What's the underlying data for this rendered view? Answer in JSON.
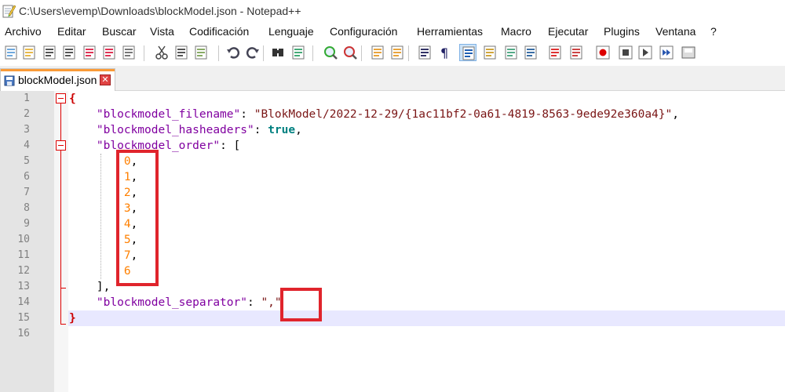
{
  "window": {
    "title": "C:\\Users\\evemp\\Downloads\\blockModel.json - Notepad++"
  },
  "menu": [
    "Archivo",
    "Editar",
    "Buscar",
    "Vista",
    "Codificación",
    "Lenguaje",
    "Configuración",
    "Herramientas",
    "Macro",
    "Ejecutar",
    "Plugins",
    "Ventana",
    "?"
  ],
  "toolbar_icons": [
    "new-file-icon",
    "open-file-icon",
    "save-icon",
    "save-all-icon",
    "close-icon",
    "close-all-icon",
    "print-icon",
    "cut-icon",
    "copy-icon",
    "paste-icon",
    "undo-icon",
    "redo-icon",
    "find-icon",
    "replace-icon",
    "zoom-in-icon",
    "zoom-out-icon",
    "sync-vertical-icon",
    "sync-horizontal-icon",
    "word-wrap-icon",
    "show-all-chars-icon",
    "indent-guide-icon",
    "user-defined-language-icon",
    "document-map-icon",
    "function-list-icon",
    "folder-as-workspace-icon",
    "monitoring-icon",
    "record-macro-icon",
    "stop-macro-icon",
    "play-macro-icon",
    "run-macro-multiple-icon",
    "save-macro-icon"
  ],
  "tab": {
    "label": "blockModel.json",
    "close_symbol": "✕"
  },
  "editor": {
    "line_numbers": [
      "1",
      "2",
      "3",
      "4",
      "5",
      "6",
      "7",
      "8",
      "9",
      "10",
      "11",
      "12",
      "13",
      "14",
      "15",
      "16"
    ],
    "current_line": 15,
    "lines": [
      [
        {
          "c": "brace",
          "t": "{"
        }
      ],
      [
        {
          "c": "p",
          "t": "    "
        },
        {
          "c": "k",
          "t": "\"blockmodel_filename\""
        },
        {
          "c": "p",
          "t": ": "
        },
        {
          "c": "s",
          "t": "\"BlokModel/2022-12-29/{1ac11bf2-0a61-4819-8563-9ede92e360a4}\""
        },
        {
          "c": "p",
          "t": ","
        }
      ],
      [
        {
          "c": "p",
          "t": "    "
        },
        {
          "c": "k",
          "t": "\"blockmodel_hasheaders\""
        },
        {
          "c": "p",
          "t": ": "
        },
        {
          "c": "b",
          "t": "true"
        },
        {
          "c": "p",
          "t": ","
        }
      ],
      [
        {
          "c": "p",
          "t": "    "
        },
        {
          "c": "k",
          "t": "\"blockmodel_order\""
        },
        {
          "c": "p",
          "t": ": ["
        }
      ],
      [
        {
          "c": "p",
          "t": "        "
        },
        {
          "c": "n",
          "t": "0"
        },
        {
          "c": "p",
          "t": ","
        }
      ],
      [
        {
          "c": "p",
          "t": "        "
        },
        {
          "c": "n",
          "t": "1"
        },
        {
          "c": "p",
          "t": ","
        }
      ],
      [
        {
          "c": "p",
          "t": "        "
        },
        {
          "c": "n",
          "t": "2"
        },
        {
          "c": "p",
          "t": ","
        }
      ],
      [
        {
          "c": "p",
          "t": "        "
        },
        {
          "c": "n",
          "t": "3"
        },
        {
          "c": "p",
          "t": ","
        }
      ],
      [
        {
          "c": "p",
          "t": "        "
        },
        {
          "c": "n",
          "t": "4"
        },
        {
          "c": "p",
          "t": ","
        }
      ],
      [
        {
          "c": "p",
          "t": "        "
        },
        {
          "c": "n",
          "t": "5"
        },
        {
          "c": "p",
          "t": ","
        }
      ],
      [
        {
          "c": "p",
          "t": "        "
        },
        {
          "c": "n",
          "t": "7"
        },
        {
          "c": "p",
          "t": ","
        }
      ],
      [
        {
          "c": "p",
          "t": "        "
        },
        {
          "c": "n",
          "t": "6"
        }
      ],
      [
        {
          "c": "p",
          "t": "    ],"
        }
      ],
      [
        {
          "c": "p",
          "t": "    "
        },
        {
          "c": "k",
          "t": "\"blockmodel_separator\""
        },
        {
          "c": "p",
          "t": ": "
        },
        {
          "c": "s",
          "t": "\",\""
        }
      ],
      [
        {
          "c": "brace",
          "t": "}"
        }
      ],
      []
    ]
  },
  "colors": {
    "key": "#8000a0",
    "string": "#7a1515",
    "number": "#ff8000",
    "boolean": "#008080",
    "annotation": "#e0242c",
    "current_line": "#e8e8ff"
  }
}
